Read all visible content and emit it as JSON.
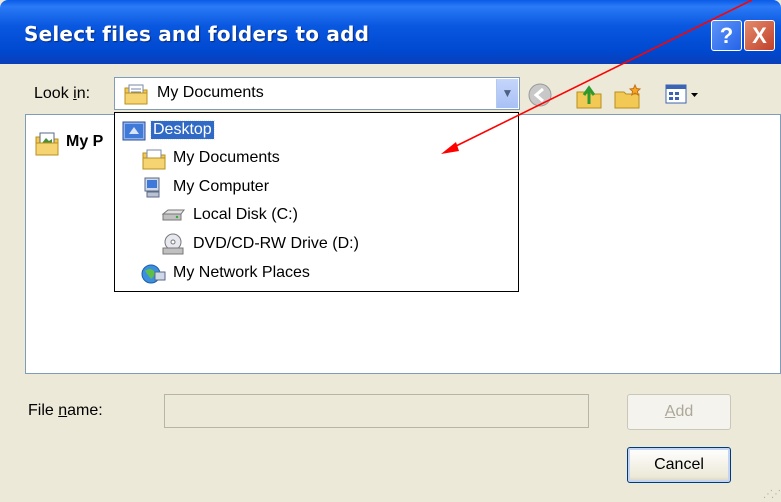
{
  "window": {
    "title": "Select files and folders to add",
    "help_label": "?",
    "close_label": "X"
  },
  "lookin": {
    "label_prefix": "Look ",
    "label_underlined": "i",
    "label_suffix": "n:",
    "value": "My Documents"
  },
  "file_list": {
    "items": [
      {
        "label": "My P",
        "icon": "my-pictures-icon"
      }
    ]
  },
  "dropdown": {
    "items": [
      {
        "label": "Desktop",
        "icon": "desktop-icon",
        "indent": 0,
        "selected": true
      },
      {
        "label": "My Documents",
        "icon": "my-documents-icon",
        "indent": 1,
        "selected": false
      },
      {
        "label": "My Computer",
        "icon": "my-computer-icon",
        "indent": 1,
        "selected": false
      },
      {
        "label": "Local Disk (C:)",
        "icon": "local-disk-icon",
        "indent": 2,
        "selected": false
      },
      {
        "label": "DVD/CD-RW Drive (D:)",
        "icon": "dvd-drive-icon",
        "indent": 2,
        "selected": false
      },
      {
        "label": "My Network Places",
        "icon": "network-places-icon",
        "indent": 1,
        "selected": false
      }
    ]
  },
  "filename": {
    "label_underlined": "n",
    "label_prefix": "File ",
    "label_suffix": "ame:",
    "value": ""
  },
  "buttons": {
    "add_underlined": "A",
    "add_suffix": "dd",
    "cancel": "Cancel"
  },
  "colors": {
    "title_blue": "#0a58e0",
    "selection": "#316ac5",
    "annotation": "#ff0000"
  }
}
